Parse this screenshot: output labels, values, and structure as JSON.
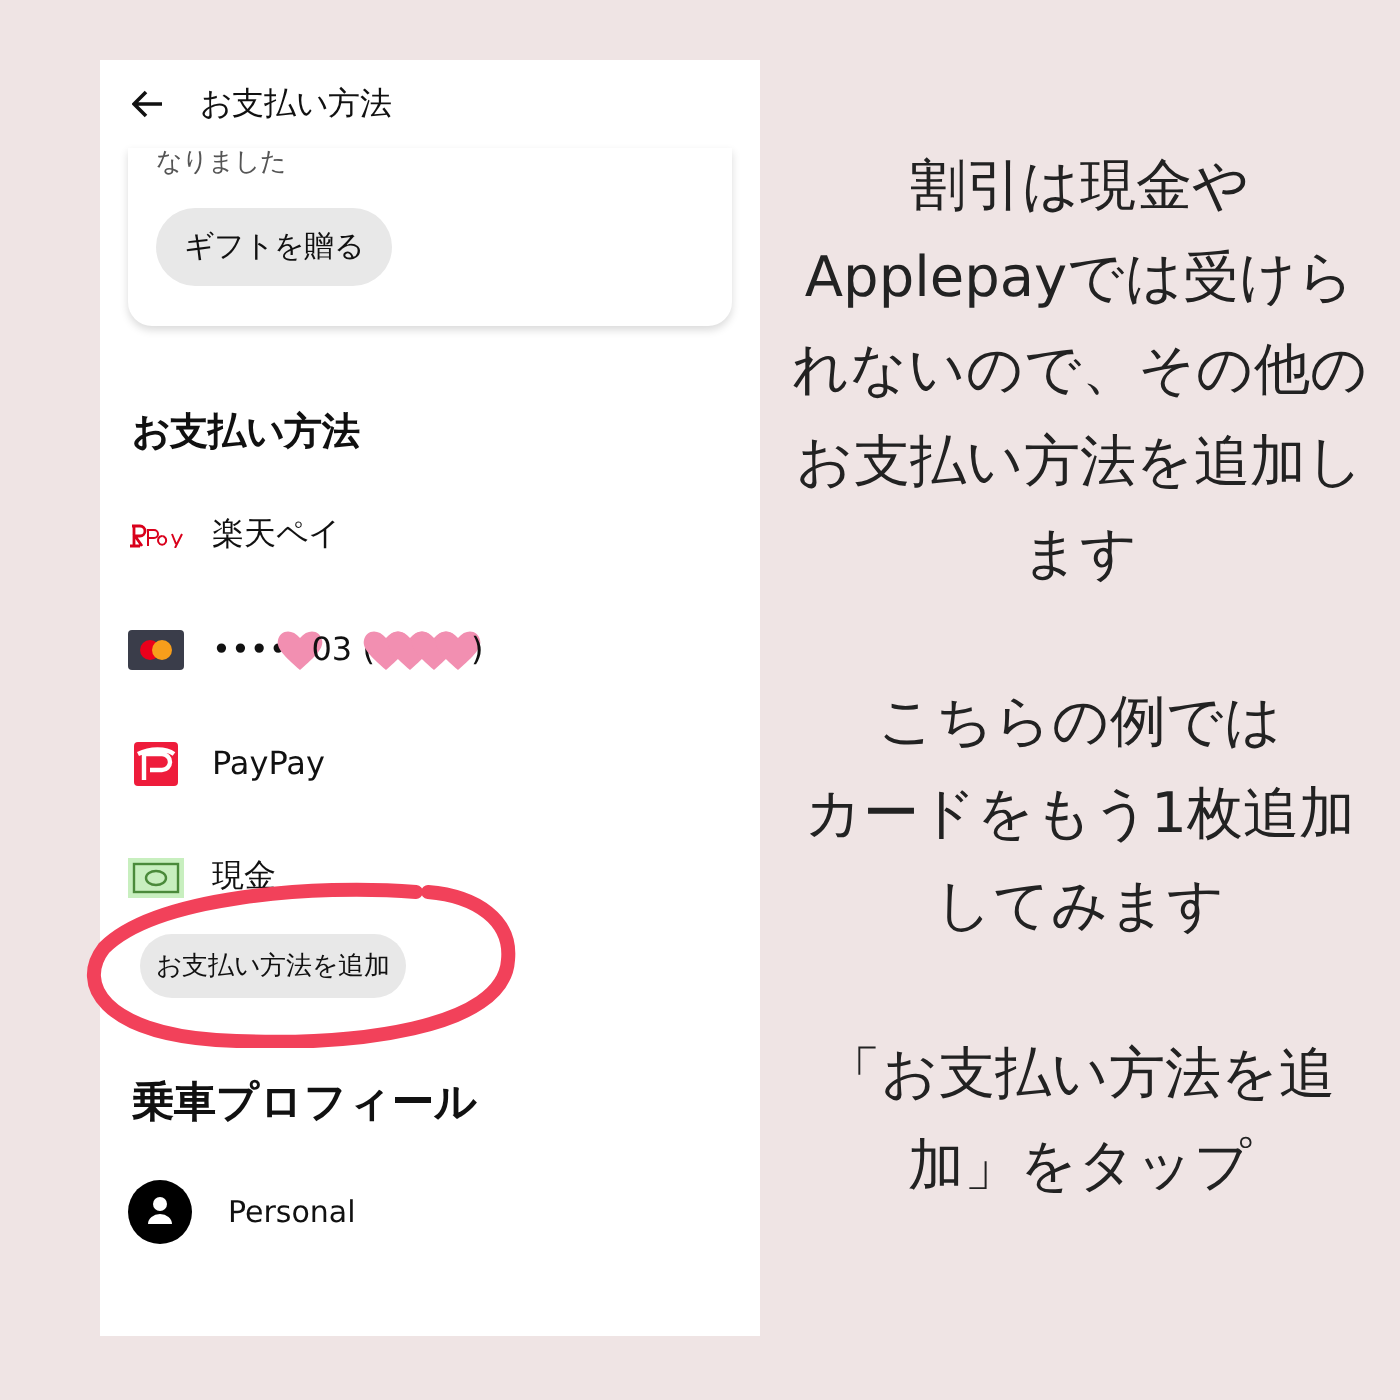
{
  "screen": {
    "title": "お支払い方法",
    "card_text": "なりました",
    "gift_button": "ギフトを贈る",
    "payment_heading": "お支払い方法",
    "payment_methods": [
      {
        "kind": "rakuten",
        "segments": [
          {
            "kind": "text",
            "text": "楽天ペイ"
          }
        ]
      },
      {
        "kind": "mastercard",
        "segments": [
          {
            "kind": "text",
            "text": "••••"
          },
          {
            "kind": "heart"
          },
          {
            "kind": "text",
            "text": "03 ("
          },
          {
            "kind": "heart"
          },
          {
            "kind": "heart"
          },
          {
            "kind": "heart"
          },
          {
            "kind": "heart"
          },
          {
            "kind": "text",
            "text": ")"
          }
        ]
      },
      {
        "kind": "paypay",
        "segments": [
          {
            "kind": "text",
            "text": "PayPay"
          }
        ]
      },
      {
        "kind": "cash",
        "segments": [
          {
            "kind": "text",
            "text": "現金"
          }
        ]
      }
    ],
    "add_button": "お支払い方法を追加",
    "profile_heading": "乗車プロフィール",
    "profile": "Personal"
  },
  "captions": [
    {
      "lines": [
        "割引は現金や",
        "Applepayでは受けら",
        "れないので、その他の",
        "お支払い方法を追加し",
        "ます"
      ]
    },
    {
      "lines": [
        "こちらの例では",
        "カードをもう1枚追加",
        "してみます"
      ]
    },
    {
      "lines": [
        "「お支払い方法を追",
        "加」をタップ"
      ]
    }
  ]
}
